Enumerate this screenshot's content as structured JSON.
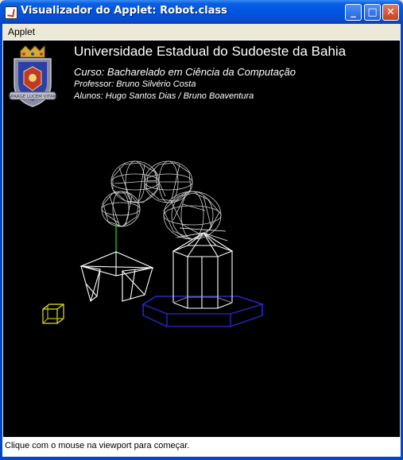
{
  "window": {
    "title": "Visualizador do Applet: Robot.class",
    "minimize_glyph": "_",
    "maximize_glyph": "□",
    "close_glyph": "✕"
  },
  "menu": {
    "items": [
      {
        "label": "Applet"
      }
    ]
  },
  "header": {
    "university": "Universidade Estadual do Sudoeste da Bahia",
    "course": "Curso: Bacharelado em Ciência da Computação",
    "professor": "Professor: Bruno Silvério Costa",
    "students": "Alunos: Hugo Santos Dias / Bruno Boaventura",
    "logo_motto": "SPARGE LUCEM VITAM"
  },
  "status": {
    "message": "Clique com o mouse na viewport para começar."
  },
  "colors": {
    "viewport_bg": "#000000",
    "wireframe_arm": "#cfcfcf",
    "wireframe_body": "#ffffff",
    "base_ring": "#2a2ad8",
    "target_cube": "#e6e619",
    "wrist_joint": "#22cc22"
  }
}
